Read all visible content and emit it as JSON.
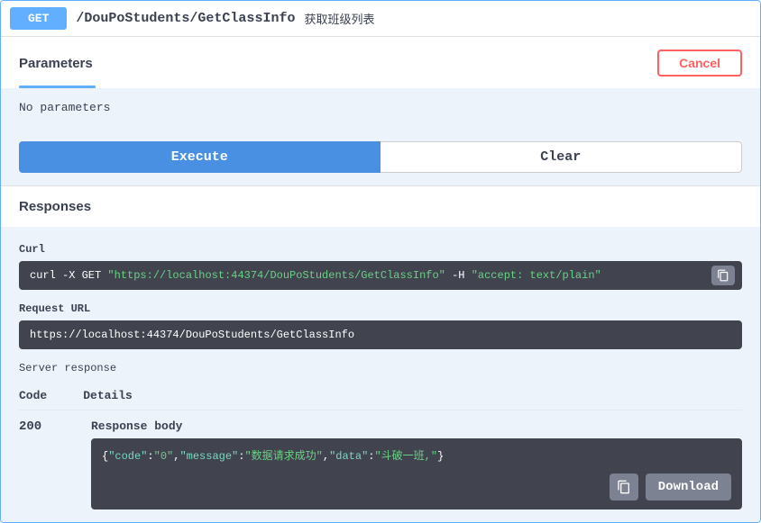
{
  "header": {
    "method": "GET",
    "path": "/DouPoStudents/GetClassInfo",
    "summary": "获取班级列表"
  },
  "parameters": {
    "title": "Parameters",
    "cancel_label": "Cancel",
    "no_params_text": "No parameters"
  },
  "buttons": {
    "execute": "Execute",
    "clear": "Clear",
    "download": "Download"
  },
  "responses": {
    "title": "Responses",
    "curl_label": "Curl",
    "curl": {
      "prefix": "curl -X GET ",
      "url": "\"https://localhost:44374/DouPoStudents/GetClassInfo\"",
      "mid": " -H ",
      "header": " \"accept: text/plain\""
    },
    "request_url_label": "Request URL",
    "request_url": "https://localhost:44374/DouPoStudents/GetClassInfo",
    "server_response_label": "Server response",
    "code_col": "Code",
    "details_col": "Details",
    "status_code": "200",
    "response_body_label": "Response body",
    "response_body": {
      "p1": "{",
      "p2": "\"code\"",
      "p3": ":",
      "p4": "\"0\"",
      "p5": ",",
      "p6": "\"message\"",
      "p7": ":",
      "p8": "\"数据请求成功\"",
      "p9": ",",
      "p10": "\"data\"",
      "p11": ":",
      "p12": "\"斗破一班,\"",
      "p13": "}"
    }
  }
}
